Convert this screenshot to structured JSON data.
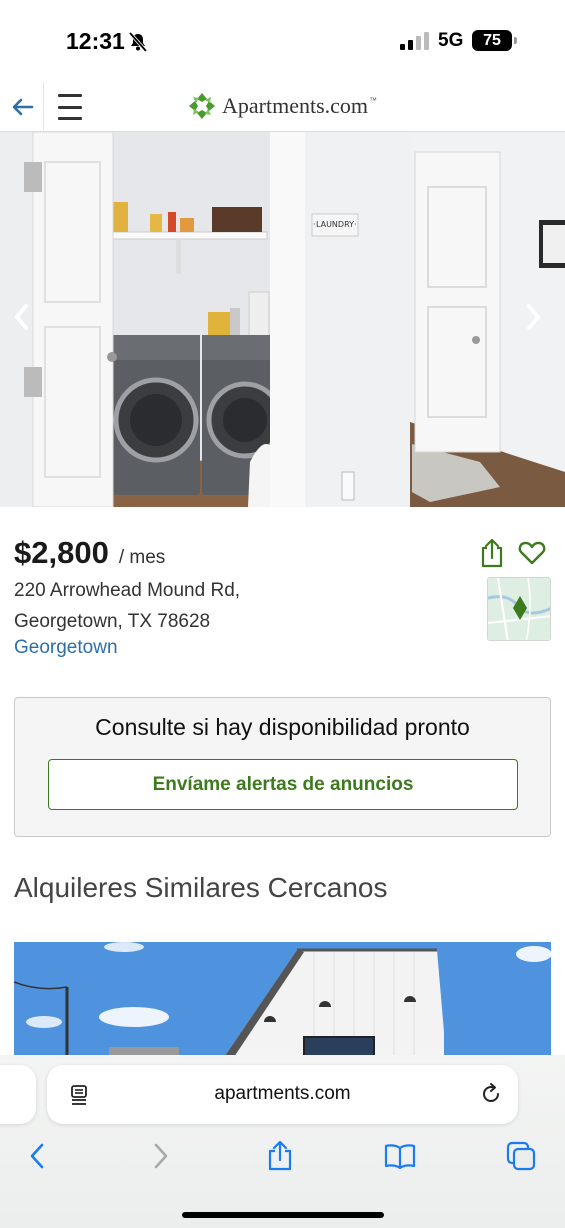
{
  "status_bar": {
    "time": "12:31",
    "network": "5G",
    "battery": "75",
    "icons": [
      "bell-slash-icon",
      "signal-icon",
      "battery-icon"
    ]
  },
  "header": {
    "brand": "Apartments.com",
    "brand_mark": "™",
    "icons": [
      "back-arrow-icon",
      "hamburger-menu-icon",
      "apartments-logo-icon"
    ],
    "brand_color": "#4a9b2f"
  },
  "photo": {
    "sign_text": "·LAUNDRY·",
    "icons": [
      "chevron-left-icon",
      "chevron-right-icon"
    ]
  },
  "listing": {
    "price": "$2,800",
    "price_unit": "/ mes",
    "address_line1": "220 Arrowhead Mound Rd,",
    "address_line2": "Georgetown, TX 78628",
    "neighborhood": "Georgetown",
    "icons": [
      "share-icon",
      "heart-icon",
      "map-pin-icon"
    ],
    "link_color": "#2e6fa5",
    "accent_color": "#3c7a1e"
  },
  "availability": {
    "title": "Consulte si hay disponibilidad pronto",
    "button_label": "Envíame alertas de anuncios"
  },
  "similar": {
    "title": "Alquileres Similares Cercanos"
  },
  "safari": {
    "url": "apartments.com",
    "icons": [
      "reader-icon",
      "reload-icon",
      "back-icon",
      "forward-icon",
      "share-icon",
      "bookmarks-icon",
      "tabs-icon"
    ]
  }
}
